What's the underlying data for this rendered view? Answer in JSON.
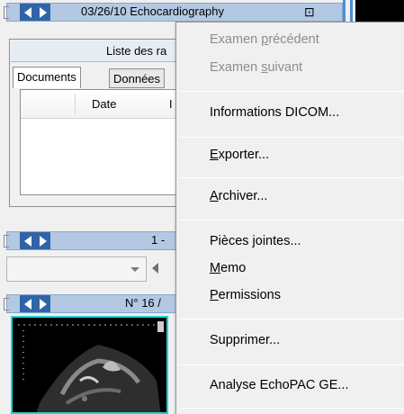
{
  "top_bar": {
    "date_title": "03/26/10 Echocardiography"
  },
  "list_panel": {
    "header": "Liste des ra",
    "tabs": [
      {
        "label": "Documents"
      },
      {
        "label": "Données"
      }
    ],
    "table": {
      "columns": [
        "Date",
        "I"
      ]
    }
  },
  "nav_bar_2": {
    "text": "1 -"
  },
  "nav_bar_3": {
    "text": "N° 16 /"
  },
  "context_menu": {
    "items": [
      {
        "label": "Examen précédent",
        "mnemonic_index": 7,
        "disabled": true
      },
      {
        "label": "Examen suivant",
        "mnemonic_index": 7,
        "disabled": true
      },
      {
        "label": "Informations DICOM...",
        "mnemonic_index": -1,
        "disabled": false
      },
      {
        "label": "Exporter...",
        "mnemonic_index": 0,
        "disabled": false
      },
      {
        "label": "Archiver...",
        "mnemonic_index": 0,
        "disabled": false
      },
      {
        "label": "Pièces jointes...",
        "mnemonic_index": -1,
        "disabled": false
      },
      {
        "label": "Memo",
        "mnemonic_index": 0,
        "disabled": false
      },
      {
        "label": "Permissions",
        "mnemonic_index": 0,
        "disabled": false
      },
      {
        "label": "Supprimer...",
        "mnemonic_index": -1,
        "disabled": false
      },
      {
        "label": "Analyse EchoPAC GE...",
        "mnemonic_index": -1,
        "disabled": false
      }
    ]
  },
  "colors": {
    "nav_blue": "#2f64a8",
    "bar_light_blue": "#b3c9e3",
    "thumbnail_border": "#1fd3d3",
    "disabled_text": "#8d8d8d"
  }
}
